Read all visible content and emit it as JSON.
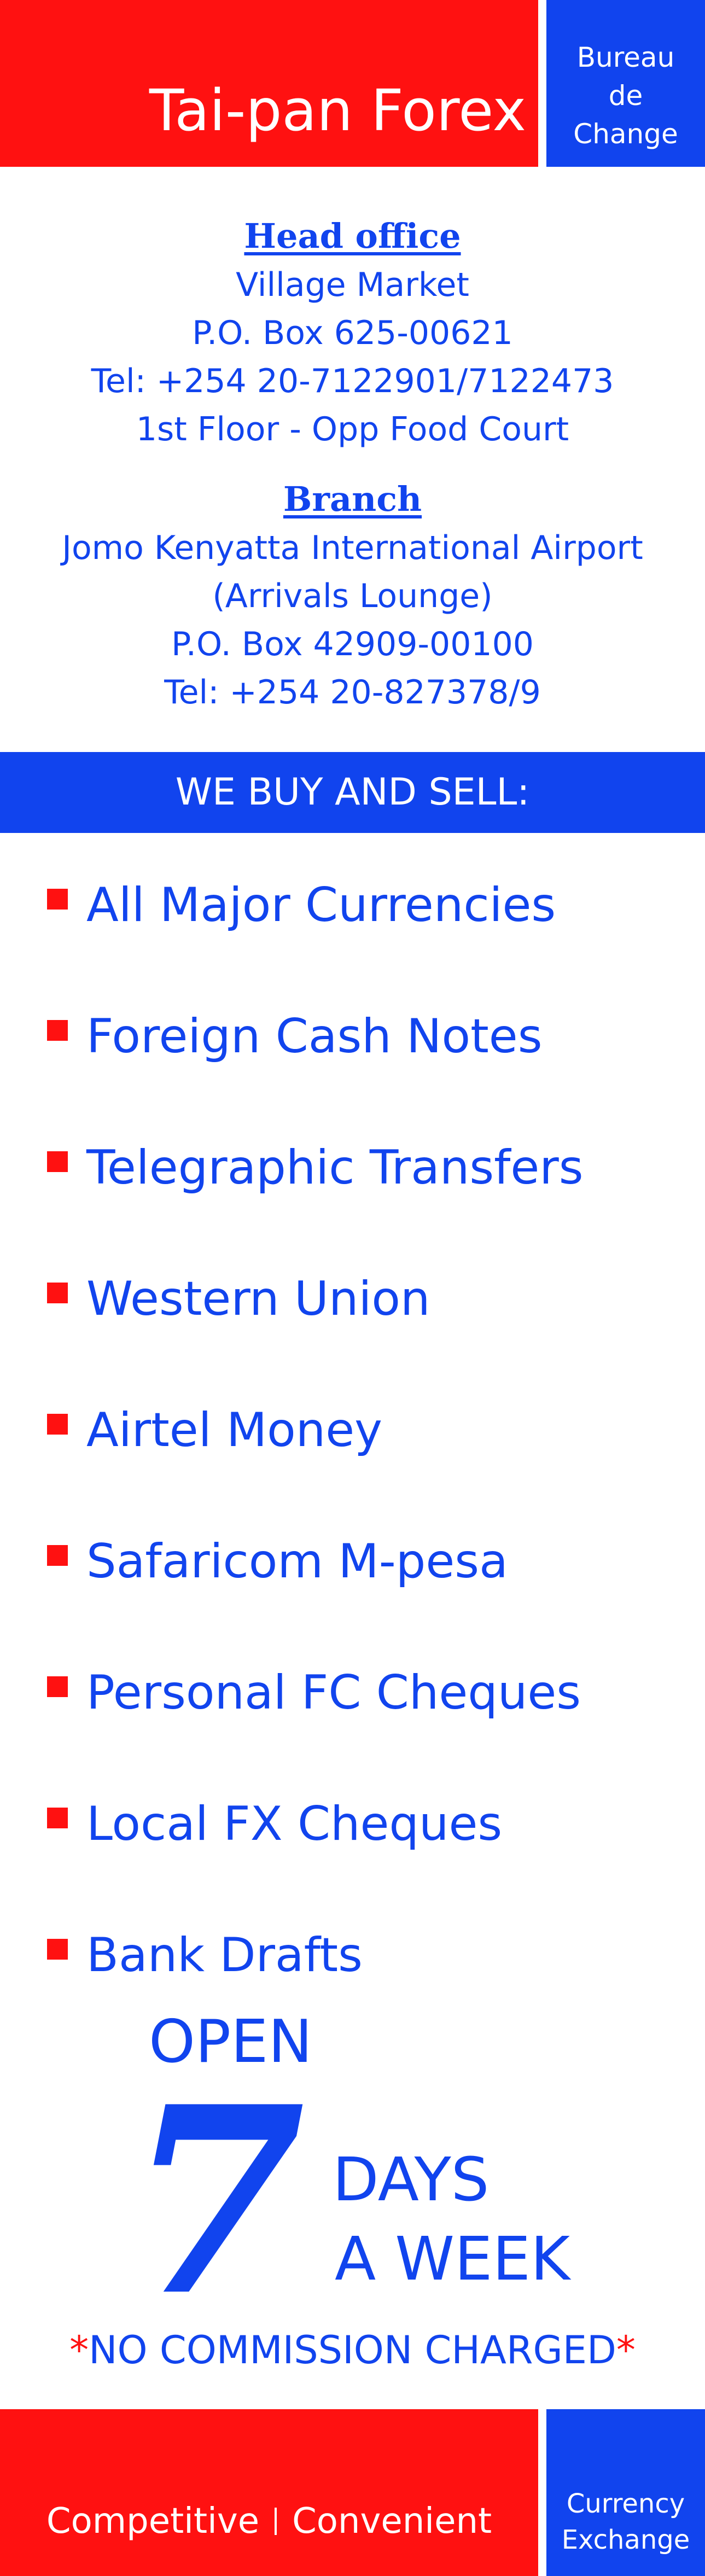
{
  "colors": {
    "red": "#ff1111",
    "blue": "#1144ee",
    "white": "#ffffff"
  },
  "header": {
    "title": "Tai-pan Forex",
    "side_lines": [
      "Bureau",
      "de",
      "Change"
    ]
  },
  "head_office": {
    "heading": "Head office",
    "lines": [
      "Village Market",
      "P.O. Box 625-00621",
      "Tel: +254 20-7122901/7122473",
      "1st Floor - Opp Food Court"
    ]
  },
  "branch": {
    "heading": "Branch",
    "lines": [
      "Jomo Kenyatta International Airport",
      "(Arrivals Lounge)",
      "P.O. Box 42909-00100",
      "Tel: +254 20-827378/9"
    ]
  },
  "band": {
    "text": "WE BUY AND SELL:"
  },
  "services": [
    "All Major Currencies",
    "Foreign Cash Notes",
    "Telegraphic Transfers",
    "Western Union",
    "Airtel Money",
    "Safaricom M-pesa",
    "Personal FC Cheques",
    "Local FX Cheques",
    "Bank Drafts"
  ],
  "open": {
    "open_label": "OPEN",
    "number": "7",
    "days_label": "DAYS",
    "week_label": "A WEEK"
  },
  "commission": {
    "star_left": "*",
    "text": "NO COMMISSION CHARGED",
    "star_right": "*"
  },
  "footer": {
    "left_word": "Competitive",
    "right_word": "Convenient",
    "side_lines": [
      "Currency",
      "Exchange"
    ]
  }
}
